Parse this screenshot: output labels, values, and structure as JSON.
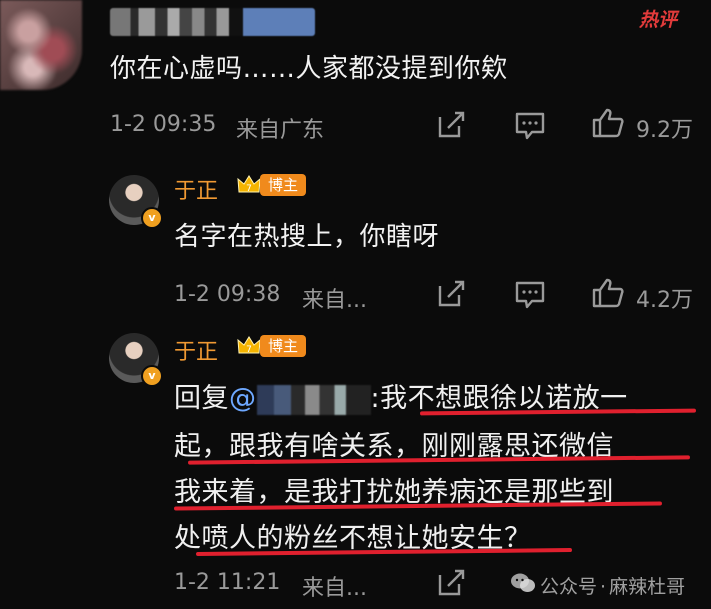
{
  "header": {
    "hot_tag": "热评"
  },
  "comment": {
    "text": "你在心虚吗……人家都没提到你欸",
    "date": "1-2 09:35",
    "location": "来自广东",
    "likes": "9.2万"
  },
  "replies": [
    {
      "username": "于正",
      "badge": "博主",
      "text": "名字在热搜上，你瞎呀",
      "date": "1-2 09:38",
      "location": "来自...",
      "likes": "4.2万"
    },
    {
      "username": "于正",
      "badge": "博主",
      "reply_prefix": "回复",
      "mention_prefix": "@",
      "lines": [
        ":我不想跟徐以诺放一",
        "起，跟我有啥关系，刚刚露思还微信",
        "我来着，是我打扰她养病还是那些到",
        "处喷人的粉丝不想让她安生？"
      ],
      "date": "1-2 11:21",
      "location": "来自..."
    }
  ],
  "watermark": {
    "prefix": "公众号",
    "separator": "·",
    "name": "麻辣杜哥"
  },
  "colors": {
    "username": "#f19a33",
    "mention": "#6ea8ff",
    "underline": "#e0202e",
    "background": "#0b0b0b"
  }
}
